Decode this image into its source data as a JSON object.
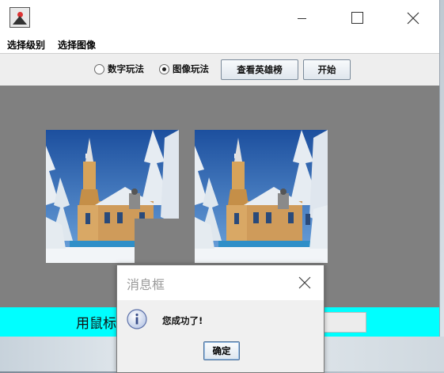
{
  "menu": {
    "items": [
      "选择级别",
      "选择图像"
    ]
  },
  "modes": [
    {
      "label": "数字玩法",
      "selected": false
    },
    {
      "label": "图像玩法",
      "selected": true
    }
  ],
  "toolbar": {
    "leaderboard_label": "查看英雄榜",
    "start_label": "开始"
  },
  "bottom": {
    "hint": "用鼠标"
  },
  "dialog": {
    "title": "消息框",
    "message": "您成功了!",
    "ok_label": "确定"
  },
  "colors": {
    "board_bg": "#808080",
    "status_bar": "#00ffff",
    "toolbar_bg": "#eeeeee"
  },
  "icons": [
    "app-icon",
    "minimize-icon",
    "maximize-icon",
    "close-icon",
    "info-icon"
  ]
}
